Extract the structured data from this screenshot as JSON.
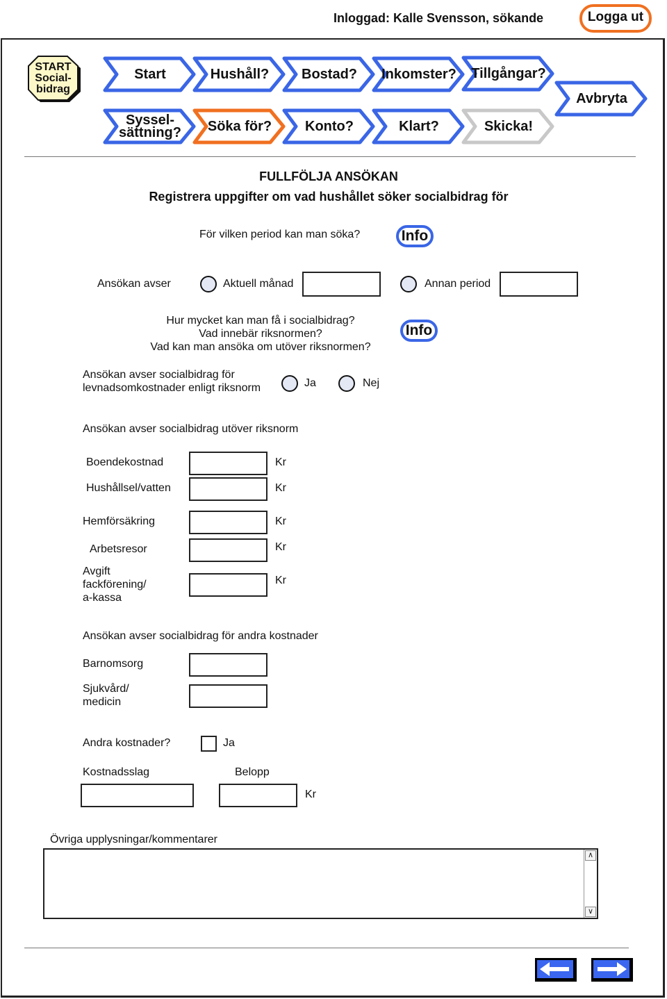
{
  "header": {
    "login_status": "Inloggad: Kalle Svensson, sökande",
    "logout_label": "Logga ut"
  },
  "start_badge": {
    "line1": "START",
    "line2": "Social-",
    "line3": "bidrag"
  },
  "nav": {
    "row1": [
      {
        "label": "Start",
        "state": "done"
      },
      {
        "label": "Hushåll?",
        "state": "done"
      },
      {
        "label": "Bostad?",
        "state": "done"
      },
      {
        "label": "Inkomster?",
        "state": "done"
      },
      {
        "label": "Tillgångar?",
        "state": "done"
      }
    ],
    "row2": [
      {
        "label_line1": "Syssel-",
        "label_line2": "sättning?",
        "state": "done"
      },
      {
        "label": "Söka för?",
        "state": "current"
      },
      {
        "label": "Konto?",
        "state": "done"
      },
      {
        "label": "Klart?",
        "state": "done"
      },
      {
        "label": "Skicka!",
        "state": "disabled"
      }
    ],
    "cancel_label": "Avbryta",
    "colors": {
      "done": "#3a66e6",
      "current": "#f07020",
      "disabled": "#c8c8c8"
    }
  },
  "page": {
    "title": "FULLFÖLJA ANSÖKAN",
    "subtitle": "Registrera uppgifter om vad hushållet söker socialbidrag för"
  },
  "period": {
    "question": "För vilken period kan man söka?",
    "info_label": "Info",
    "label": "Ansökan avser",
    "option_current_month": "Aktuell månad",
    "option_current_month_value": "",
    "option_other_period": "Annan period",
    "option_other_period_value": ""
  },
  "norm_info": {
    "line1": "Hur mycket kan man få i socialbidrag?",
    "line2": "Vad innebär riksnormen?",
    "line3": "Vad kan man ansöka om utöver riksnormen?",
    "info_label": "Info"
  },
  "norm_question": {
    "line1": "Ansökan avser socialbidrag för",
    "line2": "levnadsomkostnader enligt riksnorm",
    "yes": "Ja",
    "no": "Nej"
  },
  "beyond_norm": {
    "heading": "Ansökan avser socialbidrag utöver riksnorm",
    "currency": "Kr",
    "items": [
      {
        "label": "Boendekostnad",
        "value": ""
      },
      {
        "label": "Hushållsel/vatten",
        "value": ""
      },
      {
        "label": "Hemförsäkring",
        "value": ""
      },
      {
        "label": "Arbetsresor",
        "value": ""
      },
      {
        "label_lines": [
          "Avgift",
          "fackförening/",
          "a-kassa"
        ],
        "value": ""
      }
    ]
  },
  "other_costs": {
    "heading": "Ansökan avser socialbidrag för andra kostnader",
    "childcare_label": "Barnomsorg",
    "childcare_value": "",
    "healthcare_line1": "Sjukvård/",
    "healthcare_line2": "medicin",
    "healthcare_value": "",
    "more_question": "Andra kostnader?",
    "more_yes": "Ja",
    "more_checked": false,
    "type_label": "Kostnadsslag",
    "type_value": "",
    "amount_label": "Belopp",
    "amount_value": "",
    "currency": "Kr"
  },
  "comments": {
    "label": "Övriga upplysningar/kommentarer",
    "value": ""
  },
  "footer": {
    "back_icon": "arrow-left-icon",
    "next_icon": "arrow-right-icon"
  }
}
